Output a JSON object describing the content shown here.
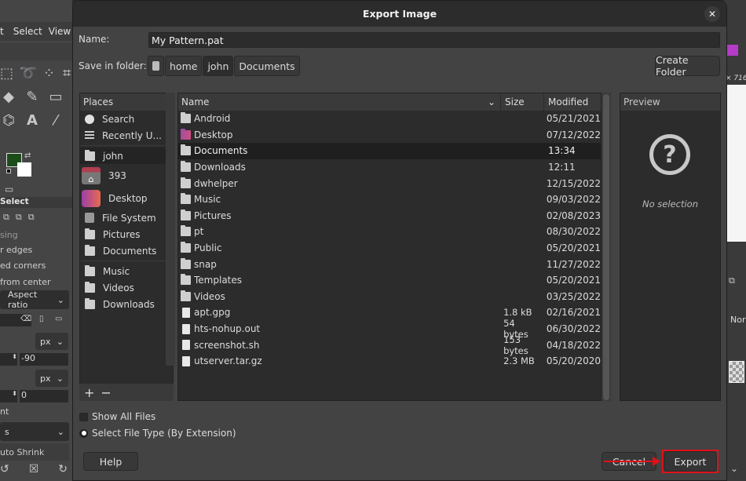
{
  "gimp_background": {
    "menu": [
      "t",
      "Select",
      "View"
    ],
    "tool_options_title": "Select",
    "options": [
      "sing",
      "r edges",
      "ed corners",
      "from center"
    ],
    "aspect_combo": "Aspect ratio",
    "unit_1": "px",
    "value_1": "-90",
    "unit_2": "px",
    "value_2": "0",
    "label_nt": "nt",
    "combo_s": "s",
    "auto_shrink": "uto Shrink",
    "right_readout": "× 716",
    "right_mode": "Nor"
  },
  "dialog": {
    "title": "Export Image",
    "name_label": "Name:",
    "name_value": "My Pattern.pat",
    "folder_label": "Save in folder:",
    "breadcrumbs": [
      "home",
      "john",
      "Documents"
    ],
    "active_crumb": "john",
    "create_folder": "Create Folder",
    "places": {
      "header": "Places",
      "items": [
        {
          "label": "Search",
          "icon": "search-icon"
        },
        {
          "label": "Recently U...",
          "icon": "recent-icon"
        },
        {
          "label": "john",
          "icon": "folder-icon",
          "selected": true
        },
        {
          "label": "393",
          "icon": "home-drive-icon"
        },
        {
          "label": "Desktop",
          "icon": "desktop-icon"
        },
        {
          "label": "File System",
          "icon": "drive-icon"
        },
        {
          "label": "Pictures",
          "icon": "folder-icon"
        },
        {
          "label": "Documents",
          "icon": "folder-icon"
        },
        {
          "label": "Music",
          "icon": "folder-icon"
        },
        {
          "label": "Videos",
          "icon": "folder-icon"
        },
        {
          "label": "Downloads",
          "icon": "folder-icon"
        }
      ],
      "add": "+",
      "remove": "−"
    },
    "files": {
      "headers": {
        "name": "Name",
        "size": "Size",
        "modified": "Modified"
      },
      "rows": [
        {
          "name": "Android",
          "size": "",
          "modified": "05/21/2021",
          "type": "folder"
        },
        {
          "name": "Desktop",
          "size": "",
          "modified": "07/12/2022",
          "type": "desktop"
        },
        {
          "name": "Documents",
          "size": "",
          "modified": "13:34",
          "type": "folder",
          "selected": true
        },
        {
          "name": "Downloads",
          "size": "",
          "modified": "12:11",
          "type": "folder"
        },
        {
          "name": "dwhelper",
          "size": "",
          "modified": "12/15/2022",
          "type": "folder"
        },
        {
          "name": "Music",
          "size": "",
          "modified": "09/03/2022",
          "type": "folder"
        },
        {
          "name": "Pictures",
          "size": "",
          "modified": "02/08/2023",
          "type": "folder"
        },
        {
          "name": "pt",
          "size": "",
          "modified": "08/30/2022",
          "type": "folder"
        },
        {
          "name": "Public",
          "size": "",
          "modified": "05/20/2021",
          "type": "folder"
        },
        {
          "name": "snap",
          "size": "",
          "modified": "11/27/2022",
          "type": "folder"
        },
        {
          "name": "Templates",
          "size": "",
          "modified": "05/20/2021",
          "type": "folder"
        },
        {
          "name": "Videos",
          "size": "",
          "modified": "03/25/2022",
          "type": "folder"
        },
        {
          "name": "apt.gpg",
          "size": "1.8 kB",
          "modified": "02/16/2021",
          "type": "file"
        },
        {
          "name": "hts-nohup.out",
          "size": "54 bytes",
          "modified": "06/30/2022",
          "type": "file"
        },
        {
          "name": "screenshot.sh",
          "size": "153 bytes",
          "modified": "04/18/2022",
          "type": "file"
        },
        {
          "name": "utserver.tar.gz",
          "size": "2.3 MB",
          "modified": "05/20/2020",
          "type": "file"
        }
      ]
    },
    "preview": {
      "header": "Preview",
      "empty_text": "No selection"
    },
    "show_all_files": "Show All Files",
    "select_file_type": "Select File Type (By Extension)",
    "help": "Help",
    "cancel": "Cancel",
    "export": "Export",
    "annotation_color": "#e0101a"
  }
}
